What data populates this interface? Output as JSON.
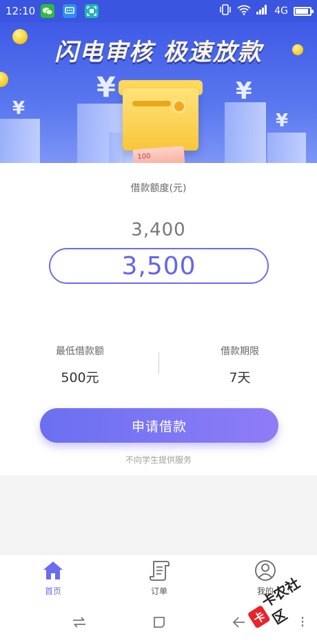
{
  "status_bar": {
    "time": "12:10",
    "network": "4G",
    "icons": [
      "wechat-icon",
      "message-icon",
      "scan-icon",
      "vibrate-icon",
      "wifi-icon",
      "signal-icon",
      "battery-icon"
    ],
    "battery_level": 0.9
  },
  "banner": {
    "title": "闪电审核 极速放款",
    "note_text": "100"
  },
  "loan": {
    "amount_label": "借款额度(元)",
    "amount_previous": "3,400",
    "amount_selected": "3,500",
    "min_label": "最低借款额",
    "min_value": "500元",
    "term_label": "借款期限",
    "term_value": "7天",
    "apply_button": "申请借款",
    "notice": "不向学生提供服务"
  },
  "tab_bar": {
    "tabs": [
      {
        "label": "首页",
        "icon": "home-icon",
        "active": true
      },
      {
        "label": "订单",
        "icon": "order-scroll-icon",
        "active": false
      },
      {
        "label": "我的",
        "icon": "profile-icon",
        "active": false
      }
    ]
  },
  "system_nav": {
    "icons": [
      "switch-icon",
      "home-square-icon",
      "back-icon",
      "menu-icon"
    ],
    "menu_glyph": "⁝"
  },
  "watermark": {
    "logo_char": "卡",
    "text": "卡农社区"
  },
  "colors": {
    "accent": "#6a6cf0",
    "banner_blue": "#3f5ae6",
    "title_cream": "#fdf6d8"
  }
}
